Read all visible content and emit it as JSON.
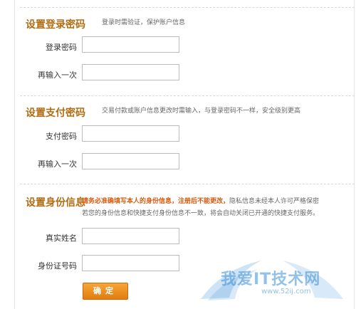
{
  "sections": {
    "login": {
      "title": "设置登录密码",
      "hint": "登录时需验证，保护账户信息",
      "fields": [
        {
          "label": "登录密码",
          "value": "",
          "placeholder": ""
        },
        {
          "label": "再输入一次",
          "value": "",
          "placeholder": ""
        }
      ]
    },
    "payment": {
      "title": "设置支付密码",
      "hint": "交易付款或账户信息更改时需输入，与登录密码不一样，安全级别更高",
      "fields": [
        {
          "label": "支付密码",
          "value": "",
          "placeholder": ""
        },
        {
          "label": "再输入一次",
          "value": "",
          "placeholder": ""
        }
      ]
    },
    "identity": {
      "title": "设置身份信息",
      "hint_warn": "请务必准确填写本人的身份信息，注册后不能更改，",
      "hint_rest": "隐私信息未经本人许可严格保密",
      "hint_line2": "若您的身份信息和快捷支付身份信息不一致，将会自动关闭已开通的快捷支付服务。",
      "fields": [
        {
          "label": "真实姓名",
          "value": "",
          "placeholder": ""
        },
        {
          "label": "身份证号码",
          "value": "",
          "placeholder": ""
        }
      ]
    }
  },
  "submit_label": "确定",
  "watermark": {
    "text": "我爱IT技术网",
    "url": "www.52ij.com"
  },
  "colors": {
    "section_title": "#b06d14",
    "warn": "#d9580b",
    "button": "#f0901f",
    "watermark": "#3a8fd8"
  }
}
